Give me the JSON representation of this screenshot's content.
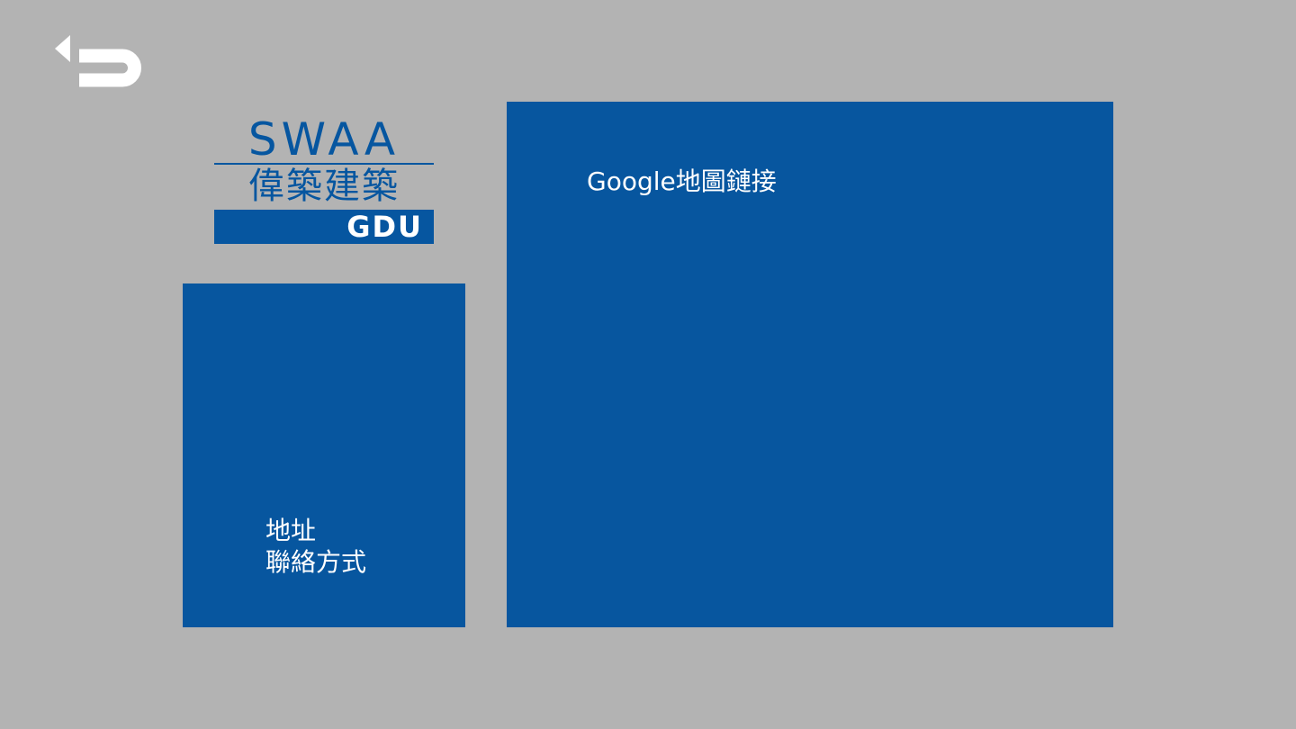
{
  "colors": {
    "background": "#b3b3b3",
    "brand_blue": "#0656a0",
    "panel_blue": "#07569f",
    "text_on_blue": "#ffffff",
    "icon": "#ffffff"
  },
  "navigation": {
    "back_icon": "return-arrow-icon"
  },
  "logo": {
    "latin": "SWAA",
    "chinese": "偉築建築",
    "bar_text": "GDU"
  },
  "info_panel": {
    "address_label": "地址",
    "contact_label": "聯絡方式"
  },
  "map_panel": {
    "link_text": "Google地圖鏈接"
  }
}
